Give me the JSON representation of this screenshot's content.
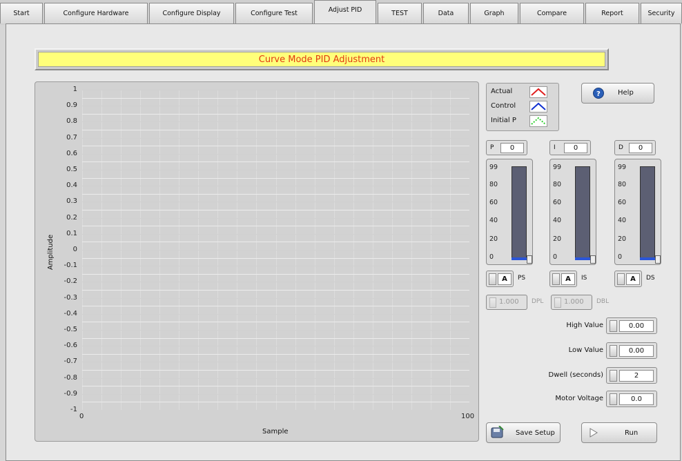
{
  "tabs": [
    {
      "label": "Start"
    },
    {
      "label": "Configure Hardware"
    },
    {
      "label": "Configure Display"
    },
    {
      "label": "Configure Test"
    },
    {
      "label": "Adjust PID",
      "active": true
    },
    {
      "label": "TEST"
    },
    {
      "label": "Data"
    },
    {
      "label": "Graph"
    },
    {
      "label": "Compare"
    },
    {
      "label": "Report"
    },
    {
      "label": "Security"
    }
  ],
  "title": "Curve Mode PID Adjustment",
  "chart_data": {
    "type": "line",
    "title": "",
    "xlabel": "Sample",
    "ylabel": "Amplitude",
    "xlim": [
      0,
      100
    ],
    "ylim": [
      -1,
      1
    ],
    "x_ticks": [
      "0",
      "100"
    ],
    "y_ticks": [
      "1",
      "0.9",
      "0.8",
      "0.7",
      "0.6",
      "0.5",
      "0.4",
      "0.3",
      "0.2",
      "0.1",
      "0",
      "-0.1",
      "-0.2",
      "-0.3",
      "-0.4",
      "-0.5",
      "-0.6",
      "-0.7",
      "-0.8",
      "-0.9",
      "-1"
    ],
    "grid": true,
    "series": [
      {
        "name": "Actual",
        "color": "#e02020",
        "values": []
      },
      {
        "name": "Control",
        "color": "#1030d0",
        "values": []
      },
      {
        "name": "Initial P",
        "color": "#30d030",
        "values": []
      }
    ]
  },
  "legend": {
    "items": [
      {
        "label": "Actual",
        "color": "#e02020"
      },
      {
        "label": "Control",
        "color": "#1030d0"
      },
      {
        "label": "Initial P",
        "color": "#30d030"
      }
    ]
  },
  "help_label": "Help",
  "sliders": [
    {
      "name": "P",
      "value": "0",
      "scale_label": "PS",
      "scale_value": "A",
      "fraction": 0
    },
    {
      "name": "I",
      "value": "0",
      "scale_label": "IS",
      "scale_value": "A",
      "fraction": 0
    },
    {
      "name": "D",
      "value": "0",
      "scale_label": "DS",
      "scale_value": "A",
      "fraction": 0
    }
  ],
  "slider_scale": [
    "99",
    "80",
    "60",
    "40",
    "20",
    "0"
  ],
  "dpl": {
    "value": "1.000",
    "label": "DPL"
  },
  "dbl": {
    "value": "1.000",
    "label": "DBL"
  },
  "fields": [
    {
      "label": "High Value",
      "value": "0.00"
    },
    {
      "label": "Low Value",
      "value": "0.00"
    },
    {
      "label": "Dwell (seconds)",
      "value": "2"
    },
    {
      "label": "Motor Voltage",
      "value": "0.0"
    }
  ],
  "save_setup_label": "Save Setup",
  "run_label": "Run"
}
